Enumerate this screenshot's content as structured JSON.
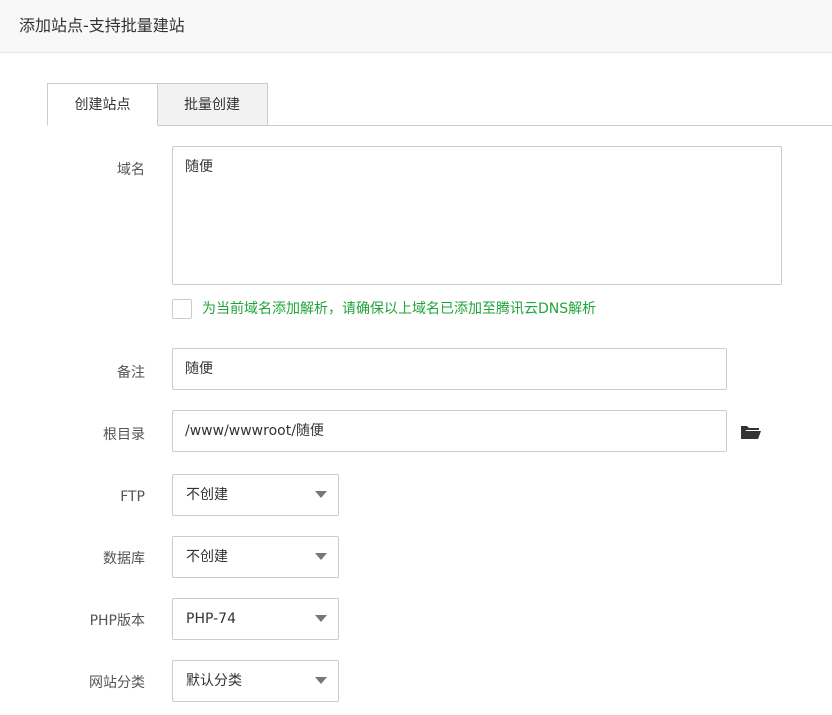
{
  "header": {
    "title": "添加站点-支持批量建站"
  },
  "tabs": [
    {
      "label": "创建站点",
      "active": true
    },
    {
      "label": "批量创建",
      "active": false
    }
  ],
  "form": {
    "domain": {
      "label": "域名",
      "value": "随便"
    },
    "dns_checkbox": {
      "checked": false,
      "label": "为当前域名添加解析，请确保以上域名已添加至腾讯云DNS解析"
    },
    "remark": {
      "label": "备注",
      "value": "随便"
    },
    "root_dir": {
      "label": "根目录",
      "value": "/www/wwwroot/随便",
      "icon": "folder-open-icon"
    },
    "ftp": {
      "label": "FTP",
      "value": "不创建"
    },
    "database": {
      "label": "数据库",
      "value": "不创建"
    },
    "php": {
      "label": "PHP版本",
      "value": "PHP-74"
    },
    "category": {
      "label": "网站分类",
      "value": "默认分类"
    }
  },
  "colors": {
    "accent_green": "#20a53a",
    "border": "#cccccc",
    "header_bg": "#f8f8f8"
  }
}
